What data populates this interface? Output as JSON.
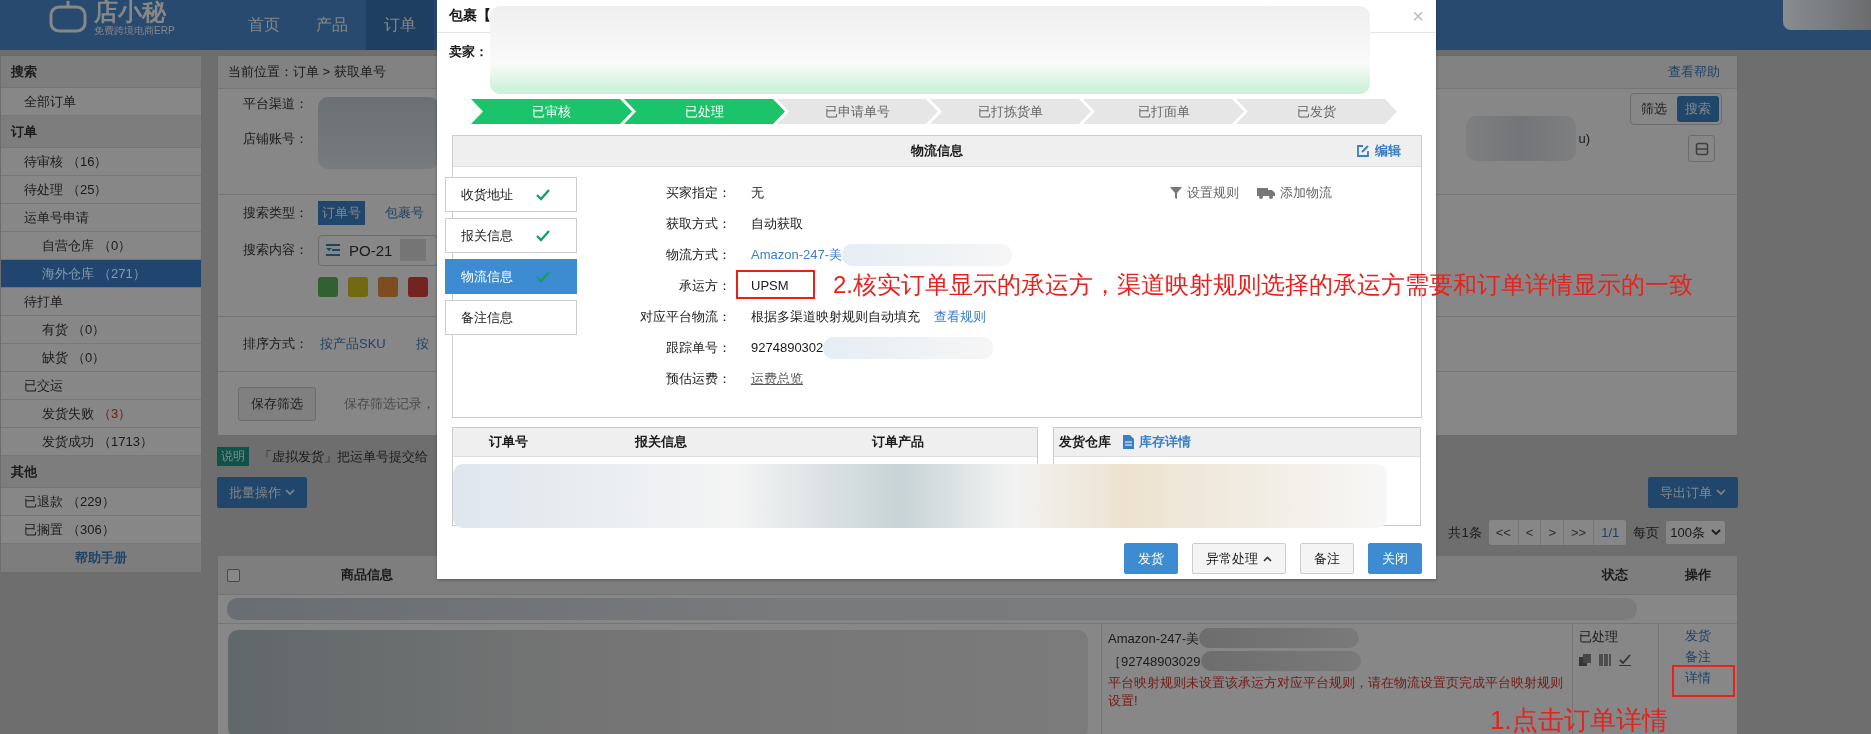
{
  "nav": {
    "logo": "店小秘",
    "logo_subtitle": "免费跨境电商ERP",
    "items": [
      {
        "label": "首页",
        "selected": false
      },
      {
        "label": "产品",
        "selected": false
      },
      {
        "label": "订单",
        "selected": true
      }
    ]
  },
  "sidebar": {
    "sections": [
      {
        "title": "搜索",
        "items": [
          {
            "label": "全部订单",
            "selected": false
          }
        ]
      },
      {
        "title": "订单",
        "items": [
          {
            "label": "待审核",
            "count": "（16）",
            "alert": false,
            "selected": false
          },
          {
            "label": "待处理",
            "count": "（25）",
            "alert": false,
            "selected": false
          },
          {
            "label": "运单号申请",
            "selected": false,
            "children": [
              {
                "label": "自营仓库",
                "count": "（0）",
                "alert": false,
                "selected": false
              },
              {
                "label": "海外仓库",
                "count": "（271）",
                "alert": false,
                "selected": true
              }
            ]
          },
          {
            "label": "待打单",
            "selected": false,
            "children": [
              {
                "label": "有货",
                "count": "（0）",
                "alert": false,
                "selected": false
              },
              {
                "label": "缺货",
                "count": "（0）",
                "alert": false,
                "selected": false
              }
            ]
          },
          {
            "label": "已交运",
            "selected": false,
            "children": [
              {
                "label": "发货失败",
                "count": "（3）",
                "alert": true,
                "selected": false
              },
              {
                "label": "发货成功",
                "count": "（1713）",
                "alert": false,
                "selected": false
              }
            ]
          }
        ]
      },
      {
        "title": "其他",
        "items": [
          {
            "label": "已退款",
            "count": "（229）",
            "alert": false,
            "selected": false
          },
          {
            "label": "已搁置",
            "count": "（306）",
            "alert": false,
            "selected": false
          }
        ]
      }
    ],
    "help_link": "帮助手册"
  },
  "page": {
    "breadcrumb": "当前位置：订单 > 获取单号",
    "help_link": "查看帮助",
    "filters": {
      "platform_label": "平台渠道：",
      "shop_label": "店铺账号：",
      "search_type_label": "搜索类型：",
      "search_types": [
        {
          "label": "订单号",
          "selected": true
        },
        {
          "label": "包裹号",
          "selected": false
        }
      ],
      "search_content_label": "搜索内容：",
      "search_value": "PO-21",
      "color_tags": [
        {
          "color": "#316131"
        },
        {
          "color": "#736910"
        },
        {
          "color": "#7b4d1f"
        },
        {
          "color": "#732320"
        }
      ],
      "sort_label": "排序方式：",
      "sort_options": [
        "按产品SKU",
        "按"
      ],
      "save_button": "保存筛选",
      "save_hint": "保存筛选记录，",
      "partial_text": "u)",
      "modes": [
        {
          "label": "筛选",
          "selected": false
        },
        {
          "label": "搜索",
          "selected": true
        }
      ]
    },
    "notice": {
      "badge": "说明",
      "text": "「虚拟发货」把运单号提交给"
    },
    "bulk_button": "批量操作",
    "export_button": "导出订单",
    "pagination": {
      "total": "共1条",
      "buttons": [
        "<<",
        "<",
        ">",
        ">>"
      ],
      "page": "1/1",
      "per_page_label": "每页",
      "per_page": "100条"
    },
    "table": {
      "select_all_checked": false,
      "columns": [
        "商品信息",
        "状态",
        "操作"
      ],
      "rows": [
        {
          "shipping": "Amazon-247-美",
          "tracking": "［92748903029",
          "warning": "平台映射规则未设置该承运方对应平台规则，请在物流设置页完成平台映射规则设置!",
          "status": "已处理",
          "actions": [
            "发货",
            "备注",
            "详情"
          ]
        }
      ]
    }
  },
  "modal": {
    "title": "包裹【",
    "close": "×",
    "seller_label": "卖家：",
    "steps": [
      {
        "label": "已审核",
        "done": true
      },
      {
        "label": "已处理",
        "done": true
      },
      {
        "label": "已申请单号",
        "done": false
      },
      {
        "label": "已打拣货单",
        "done": false
      },
      {
        "label": "已打面单",
        "done": false
      },
      {
        "label": "已发货",
        "done": false
      }
    ],
    "panel_title": "物流信息",
    "edit_link": "编辑",
    "tabs": [
      {
        "label": "收货地址",
        "checked": true,
        "selected": false
      },
      {
        "label": "报关信息",
        "checked": true,
        "selected": false
      },
      {
        "label": "物流信息",
        "checked": true,
        "selected": true
      },
      {
        "label": "备注信息",
        "checked": false,
        "selected": false
      }
    ],
    "fields": [
      {
        "kind": "text",
        "label": "买家指定：",
        "value": "无",
        "redacted": false
      },
      {
        "kind": "text",
        "label": "获取方式：",
        "value": "自动获取",
        "redacted": false
      },
      {
        "kind": "link",
        "label": "物流方式：",
        "value": "Amazon-247-美",
        "redacted": true
      },
      {
        "kind": "text",
        "label": "承运方：",
        "value": "UPSM",
        "redacted": false
      },
      {
        "kind": "text_link",
        "label": "对应平台物流：",
        "value": "根据多渠道映射规则自动填充",
        "link": "查看规则",
        "redacted": false
      },
      {
        "kind": "text",
        "label": "跟踪单号：",
        "value": "9274890302",
        "redacted": true
      },
      {
        "kind": "underline",
        "label": "预估运费：",
        "value": "运费总览",
        "redacted": false
      }
    ],
    "tools": [
      {
        "kind": "filter",
        "label": "设置规则"
      },
      {
        "kind": "truck",
        "label": "添加物流"
      }
    ],
    "order_columns": [
      "订单号",
      "报关信息",
      "订单产品"
    ],
    "warehouse_label": "发货仓库",
    "stock_link": "库存详情",
    "buttons": [
      {
        "kind": "primary",
        "label": "发货"
      },
      {
        "kind": "dropdown",
        "label": "异常处理"
      },
      {
        "kind": "default",
        "label": "备注"
      },
      {
        "kind": "primary",
        "label": "关闭"
      }
    ]
  },
  "annotations": [
    {
      "kind": "boxed_note",
      "text": "2.核实订单显示的承运方，渠道映射规则选择的承运方需要和订单详情显示的一致"
    },
    {
      "kind": "boxed_note",
      "text": "1.点击订单详情"
    }
  ]
}
